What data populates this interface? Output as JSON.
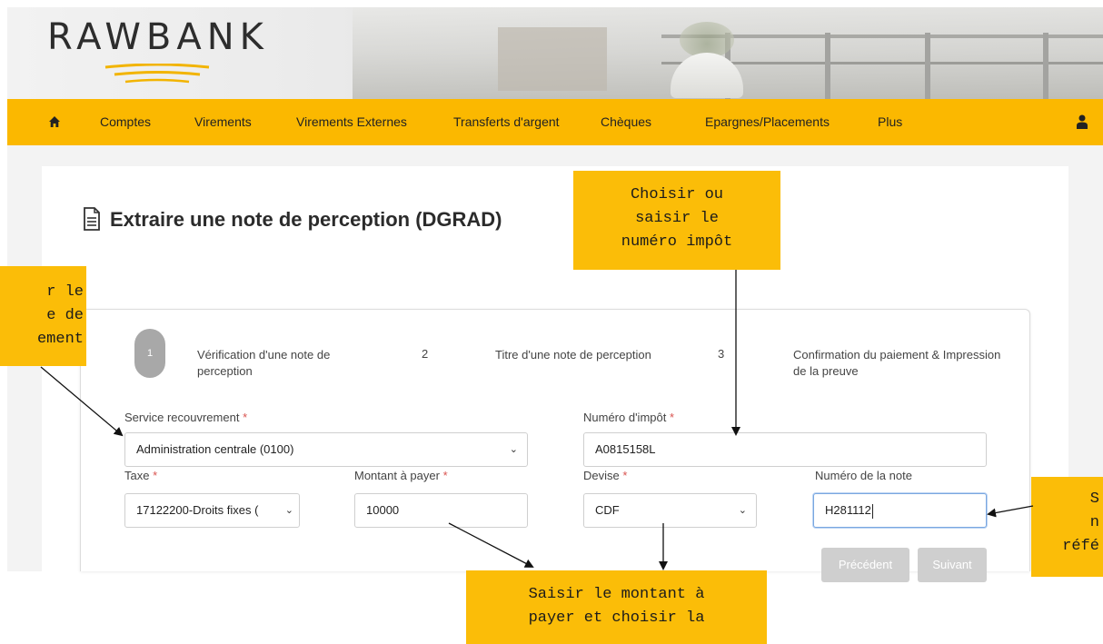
{
  "brand": {
    "logo_text": "RAWBANK",
    "primary_color": "#fbb800",
    "callout_color": "#fbbd08"
  },
  "nav": {
    "home_icon": "home-icon",
    "items": [
      "Comptes",
      "Virements",
      "Virements Externes",
      "Transferts d'argent",
      "Chèques",
      "Epargnes/Placements",
      "Plus"
    ],
    "user_icon": "user-icon"
  },
  "page": {
    "title_icon": "document-icon",
    "title": "Extraire une note de perception (DGRAD)"
  },
  "steps": [
    {
      "number": "1",
      "label": "Vérification d'une note de perception",
      "active": true
    },
    {
      "number": "2",
      "label": "Titre d'une note de perception",
      "active": false
    },
    {
      "number": "3",
      "label": "Confirmation du paiement & Impression de la preuve",
      "active": false
    }
  ],
  "form": {
    "service": {
      "label": "Service recouvrement",
      "required_mark": "*",
      "value": "Administration centrale (0100)"
    },
    "tax_number": {
      "label": "Numéro d'impôt",
      "required_mark": "*",
      "value": "A0815158L"
    },
    "taxe": {
      "label": "Taxe",
      "required_mark": "*",
      "value": "17122200-Droits fixes ("
    },
    "amount": {
      "label": "Montant à payer",
      "required_mark": "*",
      "value": "10000"
    },
    "currency": {
      "label": "Devise",
      "required_mark": "*",
      "value": "CDF"
    },
    "note_number": {
      "label": "Numéro de la note",
      "value": "H281112"
    },
    "prev_button": "Précédent",
    "next_button": "Suivant"
  },
  "callouts": {
    "tax_number": "Choisir ou\nsaisir le\nnuméro impôt",
    "service": "r le\ne de\nement",
    "note_number": "S\nn\nréfé",
    "amount": "Saisir le montant à\npayer et choisir la"
  }
}
